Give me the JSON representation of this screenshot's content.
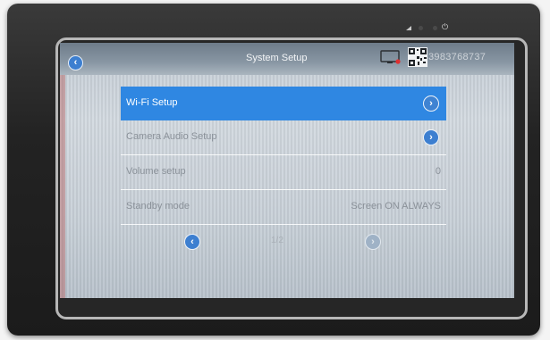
{
  "header": {
    "title": "System Setup",
    "serial": "3983768737"
  },
  "menu": {
    "items": [
      {
        "label": "Wi-Fi Setup",
        "value": "",
        "selected": true
      },
      {
        "label": "Camera Audio Setup",
        "value": ""
      },
      {
        "label": "Volume setup",
        "value": "0"
      },
      {
        "label": "Standby mode",
        "value": "Screen ON ALWAYS"
      }
    ]
  },
  "pager": {
    "page": "1/2"
  },
  "icons": {
    "back": "chevron-left-icon",
    "next": "chevron-right-icon",
    "tablet": "tablet-icon",
    "qr": "qr-code-icon",
    "power": "power-icon"
  },
  "colors": {
    "accent": "#2f87e2",
    "button": "#3d7fd0"
  }
}
